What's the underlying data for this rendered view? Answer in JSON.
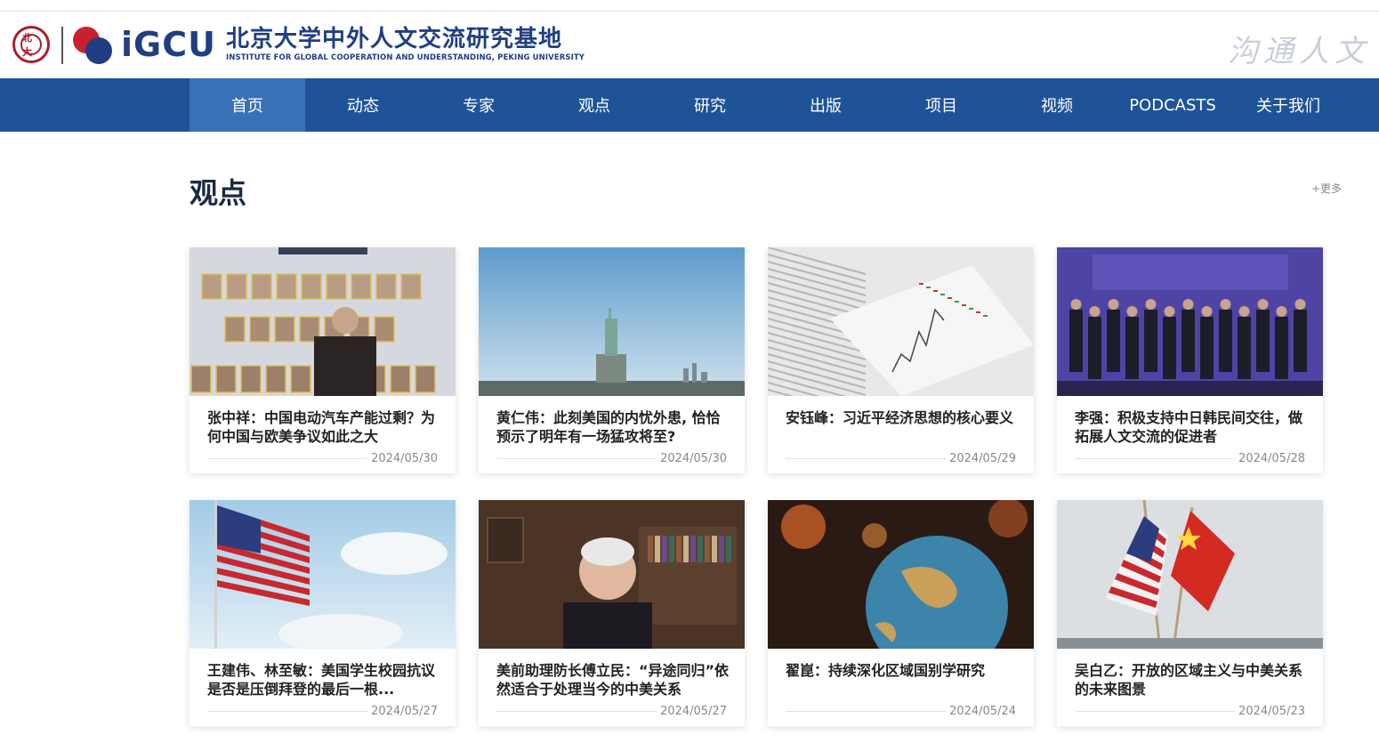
{
  "header": {
    "logo_text": "iGCU",
    "title_cn": "北京大学中外人文交流研究基地",
    "title_en": "INSTITUTE FOR GLOBAL COOPERATION AND UNDERSTANDING, PEKING UNIVERSITY",
    "slogan": "沟通人文"
  },
  "nav": {
    "items": [
      {
        "label": "首页",
        "active": true
      },
      {
        "label": "动态"
      },
      {
        "label": "专家"
      },
      {
        "label": "观点"
      },
      {
        "label": "研究"
      },
      {
        "label": "出版"
      },
      {
        "label": "项目"
      },
      {
        "label": "视频"
      },
      {
        "label": "PODCASTS"
      },
      {
        "label": "关于我们"
      }
    ]
  },
  "section": {
    "title": "观点",
    "more": "+更多"
  },
  "articles": [
    {
      "title": "张中祥：中国电动汽车产能过剩？为何中国与欧美争议如此之大",
      "date": "2024/05/30"
    },
    {
      "title": "黄仁伟：此刻美国的内忧外患, 恰恰预示了明年有一场猛攻将至?",
      "date": "2024/05/30"
    },
    {
      "title": "安钰峰：习近平经济思想的核心要义",
      "date": "2024/05/29"
    },
    {
      "title": "李强：积极支持中日韩民间交往，做拓展人文交流的促进者",
      "date": "2024/05/28"
    },
    {
      "title": "王建伟、林至敏：美国学生校园抗议是否是压倒拜登的最后一根...",
      "date": "2024/05/27"
    },
    {
      "title": "美前助理防长傅立民：“异途同归”依然适合于处理当今的中美关系",
      "date": "2024/05/27"
    },
    {
      "title": "翟崑：持续深化区域国别学研究",
      "date": "2024/05/24"
    },
    {
      "title": "吴白乙：开放的区域主义与中美关系的未来图景",
      "date": "2024/05/23"
    }
  ]
}
